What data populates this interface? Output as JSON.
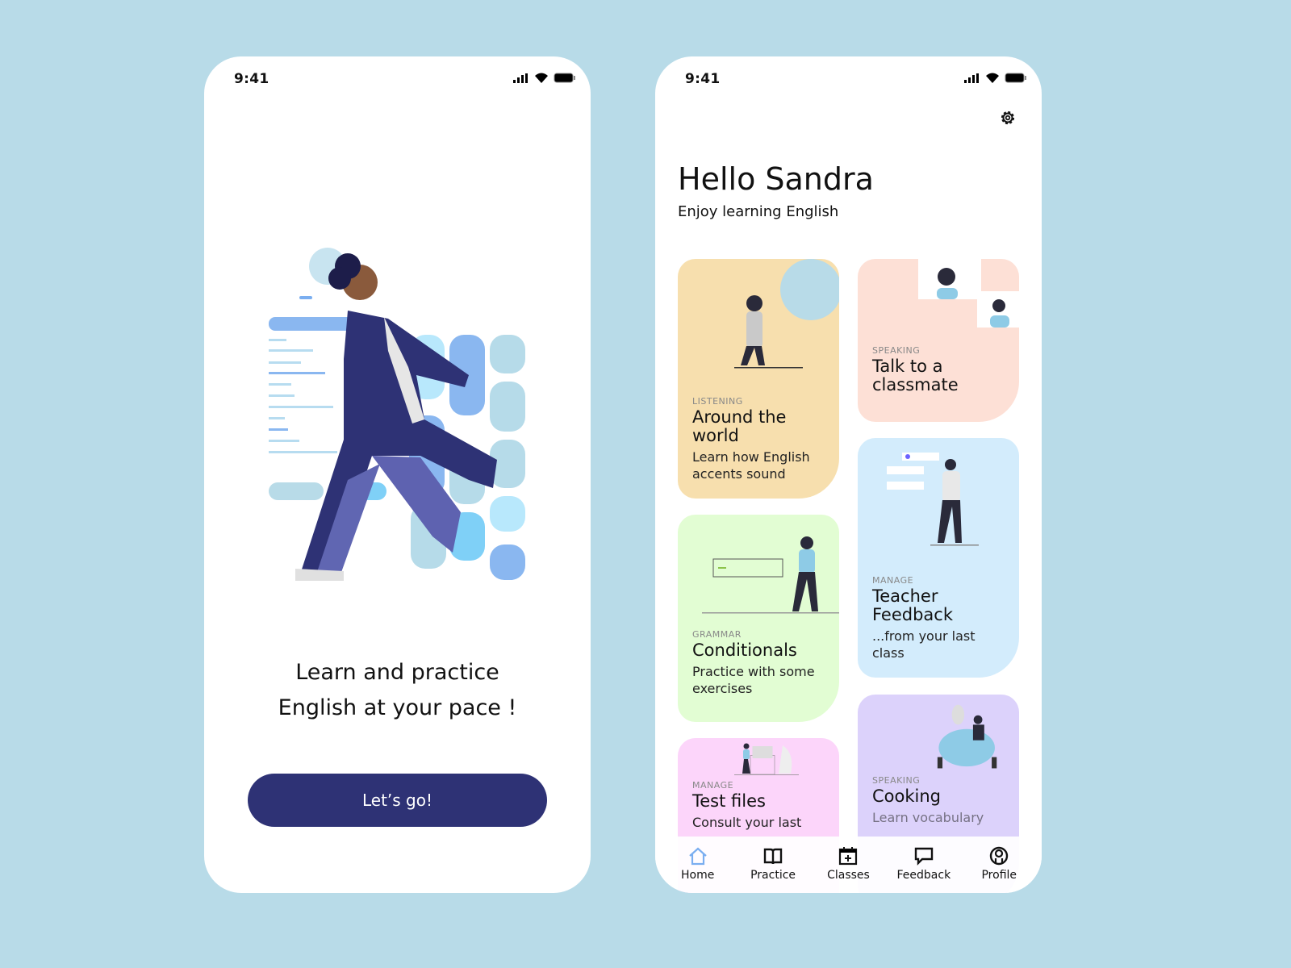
{
  "welcome": {
    "time": "9:41",
    "tagline_line1": "Learn and practice",
    "tagline_line2": "English at your pace !",
    "cta": "Let’s go!"
  },
  "home": {
    "time": "9:41",
    "greeting": "Hello Sandra",
    "subtitle": "Enjoy learning English",
    "cards": [
      {
        "category": "LISTENING",
        "title": "Around the world",
        "description": "Learn how English accents sound",
        "color": "#f7dfae"
      },
      {
        "category": "SPEAKING",
        "title": "Talk to a classmate",
        "description": "",
        "color": "#fde0d6"
      },
      {
        "category": "MANAGE",
        "title": "Teacher Feedback",
        "description": " ...from your last class",
        "color": "#d3ecfc"
      },
      {
        "category": "GRAMMAR",
        "title": "Conditionals",
        "description": "Practice with some exercises",
        "color": "#e2fdd3"
      },
      {
        "category": "MANAGE",
        "title": "Test files",
        "description": "Consult your last",
        "color": "#fcd5fa"
      },
      {
        "category": "SPEAKING",
        "title": "Cooking",
        "description": "Learn vocabulary",
        "color": "#dcd2fb"
      }
    ],
    "nav": [
      {
        "label": "Home",
        "icon": "home-icon",
        "active": true
      },
      {
        "label": "Practice",
        "icon": "book-icon"
      },
      {
        "label": "Classes",
        "icon": "calendar-icon"
      },
      {
        "label": "Feedback",
        "icon": "chat-icon"
      },
      {
        "label": "Profile",
        "icon": "profile-icon"
      }
    ],
    "accent": "#7aaef0"
  }
}
